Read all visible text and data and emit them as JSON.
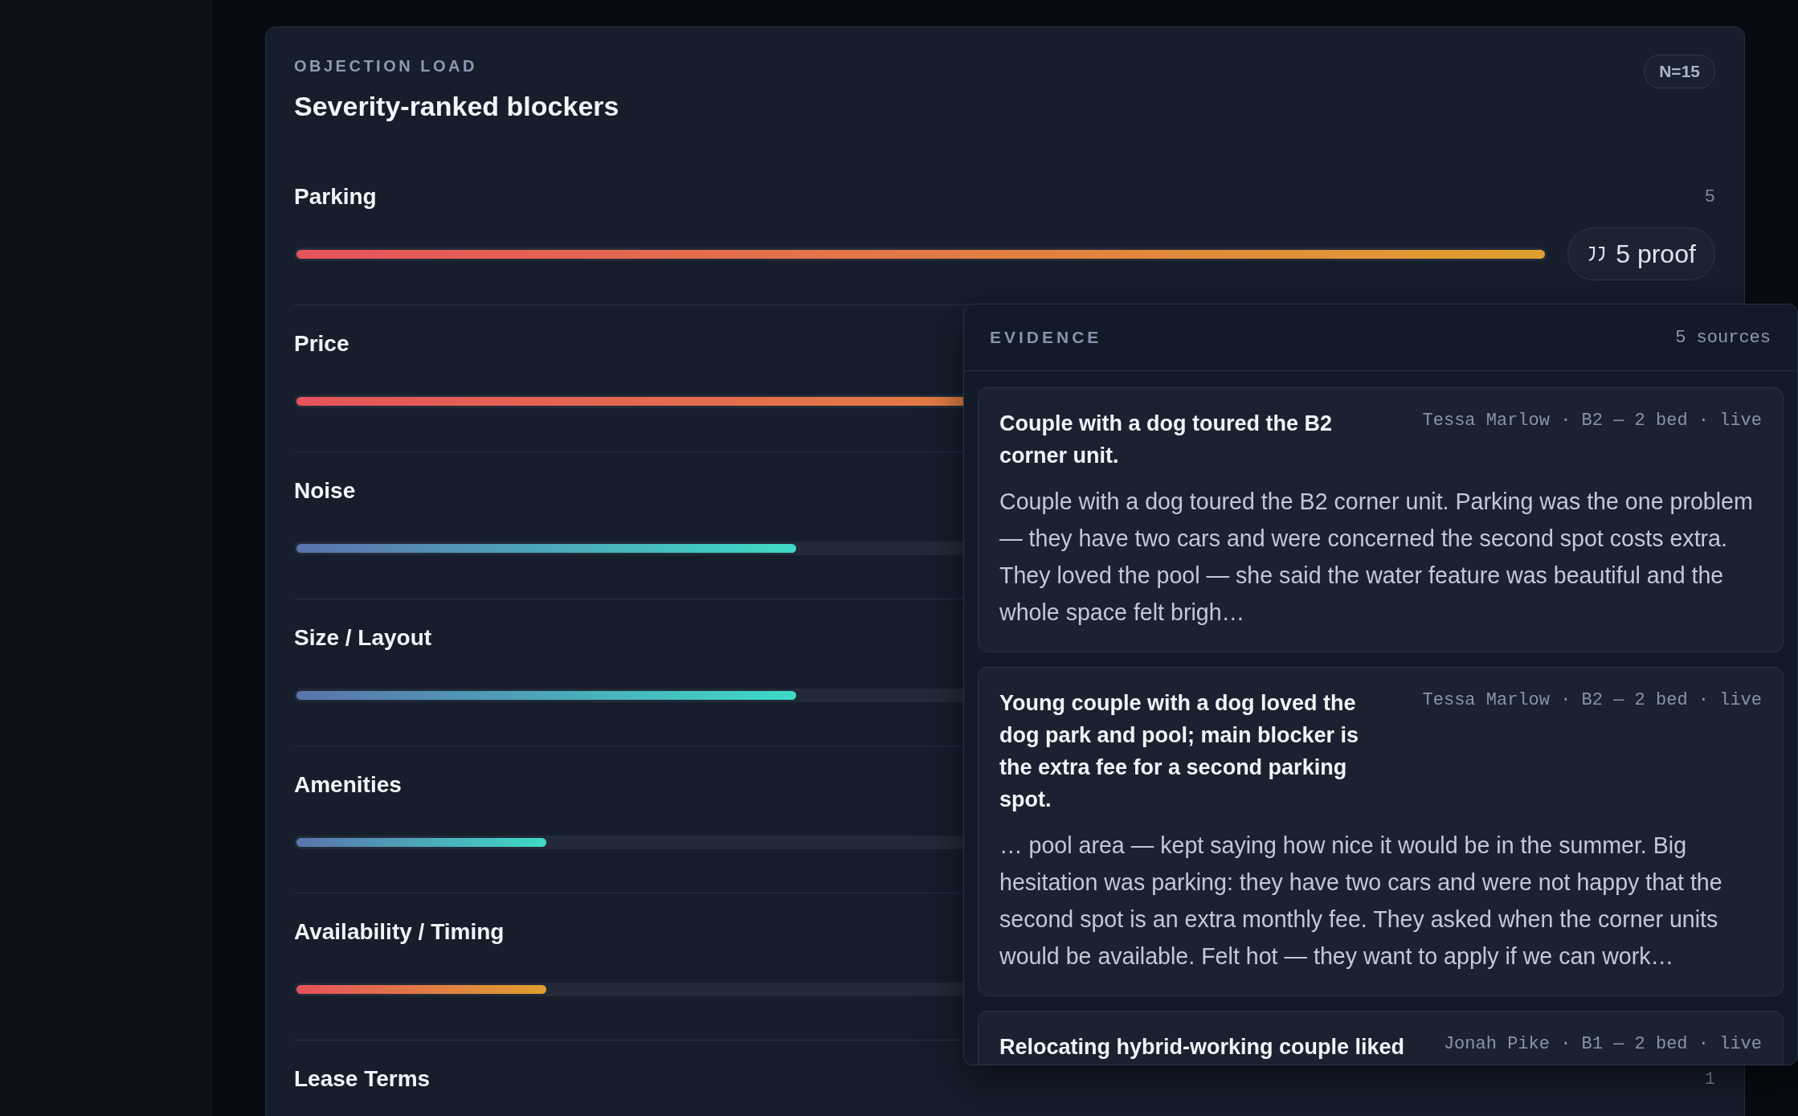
{
  "panel": {
    "overline": "OBJECTION LOAD",
    "title": "Severity-ranked blockers",
    "badge": "N=15"
  },
  "blockers": [
    {
      "label": "Parking",
      "count": "5",
      "kind": "hot",
      "level": 1,
      "proof": "5 proof"
    },
    {
      "label": "Price",
      "kind": "hot",
      "level": 1
    },
    {
      "label": "Noise",
      "kind": "cool",
      "level": 0.4
    },
    {
      "label": "Size / Layout",
      "kind": "cool",
      "level": 0.4
    },
    {
      "label": "Amenities",
      "kind": "cool",
      "level": 0.2
    },
    {
      "label": "Availability / Timing",
      "kind": "hot",
      "level": 0.2
    },
    {
      "label": "Lease Terms",
      "count": "1"
    }
  ],
  "evidence": {
    "title": "EVIDENCE",
    "count": "5 sources",
    "items": [
      {
        "title": "Couple with a dog toured the B2 corner unit.",
        "meta": "Tessa Marlow · B2 — 2 bed · live",
        "excerpt": "Couple with a dog toured the B2 corner unit. Parking was the one problem — they have two cars and were concerned the second spot costs extra. They loved the pool — she said the water feature was beautiful and the whole space felt brigh…"
      },
      {
        "title": "Young couple with a dog loved the dog park and pool; main blocker is the extra fee for a second parking spot.",
        "meta": "Tessa Marlow · B2 — 2 bed · live",
        "excerpt": "… pool area — kept saying how nice it would be in the summer. Big hesitation was parking: they have two cars and were not happy that the second spot is an extra monthly fee. They asked when the corner units would be available. Felt hot — they want to apply if we can work…"
      },
      {
        "title": "Relocating hybrid-working couple liked",
        "meta": "Jonah Pike · B1 — 2 bed · live"
      }
    ]
  }
}
